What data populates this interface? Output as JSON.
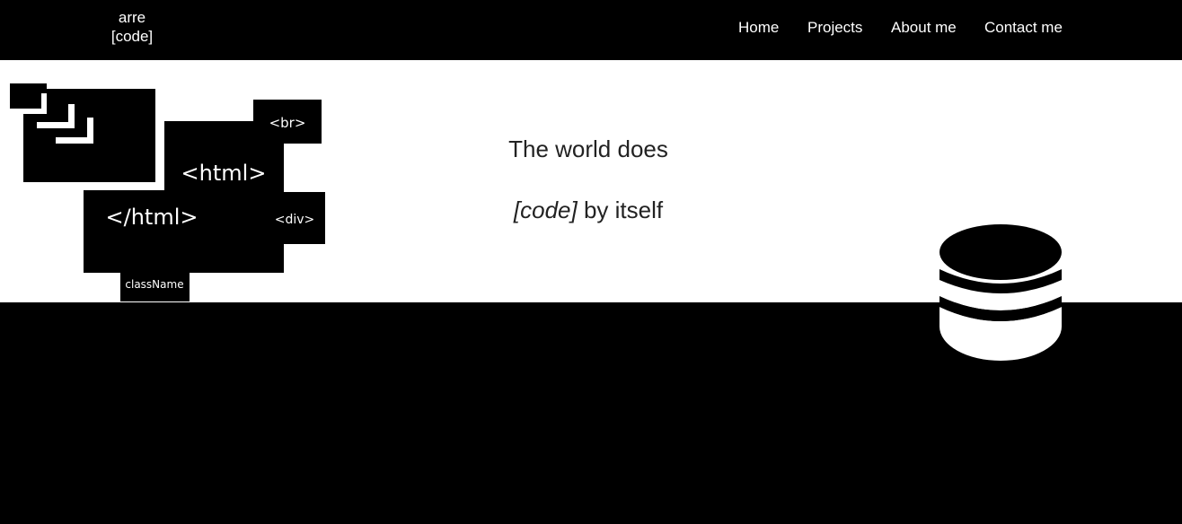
{
  "brand": {
    "line1": "arre",
    "line2": "[code]"
  },
  "nav": {
    "items": [
      {
        "label": "Home"
      },
      {
        "label": "Projects"
      },
      {
        "label": "About me"
      },
      {
        "label": "Contact me"
      }
    ]
  },
  "hero": {
    "line1": "The world does",
    "line2_em": "[code]",
    "line2_rest": " by itself"
  },
  "art": {
    "tags": {
      "br": "<br>",
      "html_open": "<html>",
      "html_close": "</html>",
      "div": "<div>",
      "class_name": "className"
    },
    "icons": [
      "window-icon",
      "database-icon"
    ]
  },
  "colors": {
    "background": "#000000",
    "hero_background": "#ffffff",
    "text_dark": "#222222",
    "text_light": "#ffffff"
  }
}
